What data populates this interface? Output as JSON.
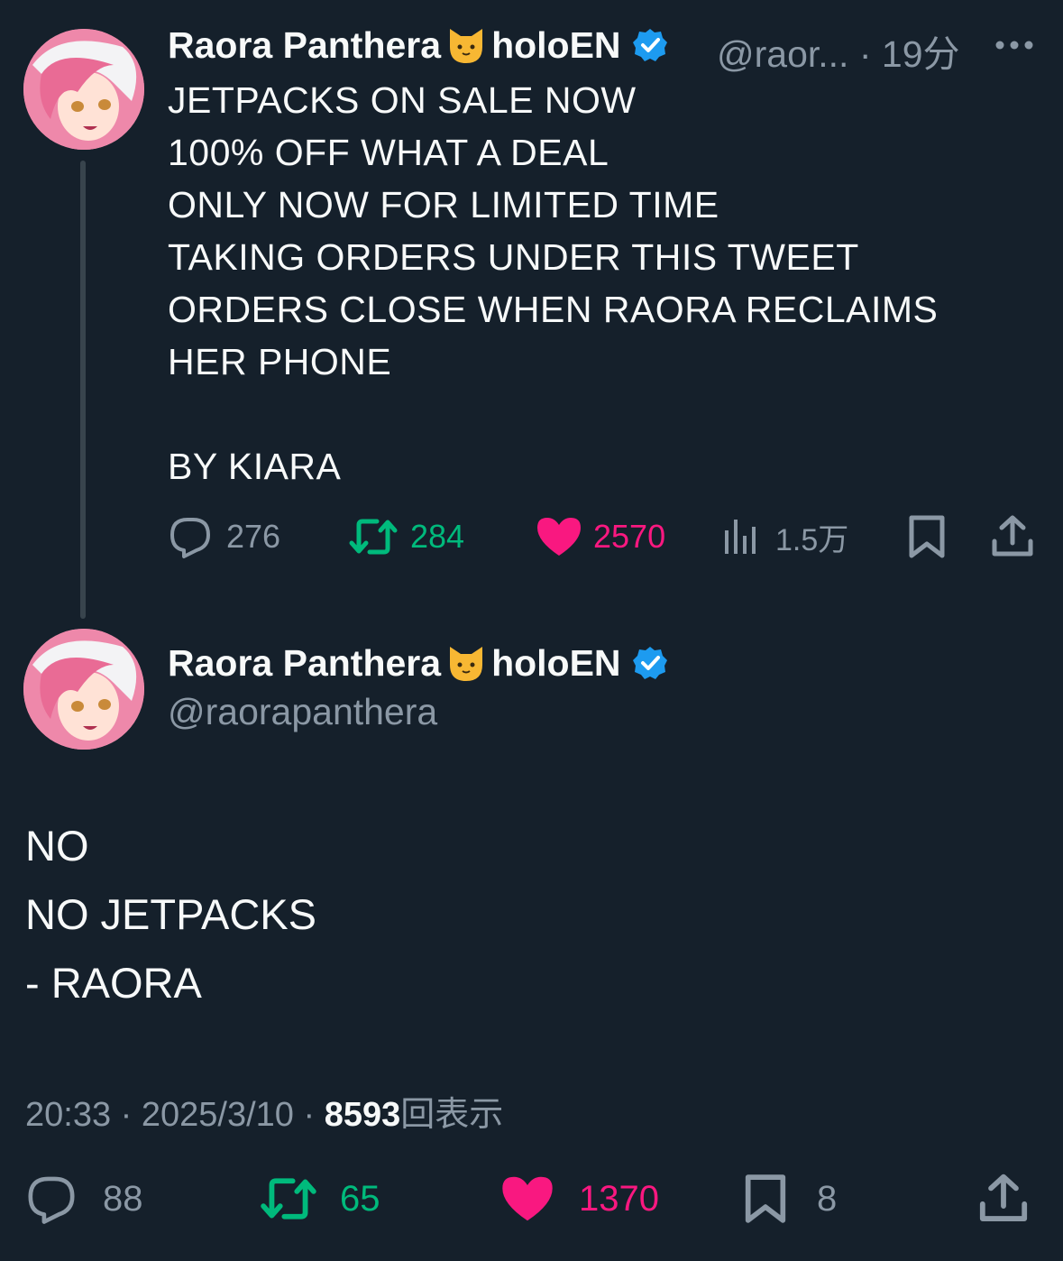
{
  "tweet1": {
    "display_name": "Raora Panthera",
    "name_suffix": "holoEN",
    "handle": "@raor...",
    "separator": "·",
    "time": "19分",
    "more_icon": "ellipsis-icon",
    "text": "JETPACKS ON SALE NOW\n100% OFF WHAT A DEAL\nONLY NOW FOR LIMITED TIME\nTAKING ORDERS UNDER THIS TWEET\nORDERS CLOSE WHEN RAORA RECLAIMS\nHER PHONE\n\nBY KIARA",
    "stats": {
      "replies": "276",
      "retweets": "284",
      "likes": "2570",
      "views": "1.5万"
    }
  },
  "tweet2": {
    "display_name": "Raora Panthera",
    "name_suffix": "holoEN",
    "handle": "@raorapanthera",
    "text": "NO\nNO JETPACKS\n- RAORA",
    "meta": {
      "time": "20:33",
      "sep1": "·",
      "date": "2025/3/10",
      "sep2": "·",
      "views_count": "8593",
      "views_label": "回表示"
    },
    "stats": {
      "replies": "88",
      "retweets": "65",
      "likes": "1370",
      "bookmarks": "8"
    }
  },
  "colors": {
    "background": "#15202b",
    "text": "#f7f9f9",
    "muted": "#8b98a5",
    "retweet": "#00ba7c",
    "like": "#f91880",
    "verified": "#1d9bf0"
  }
}
